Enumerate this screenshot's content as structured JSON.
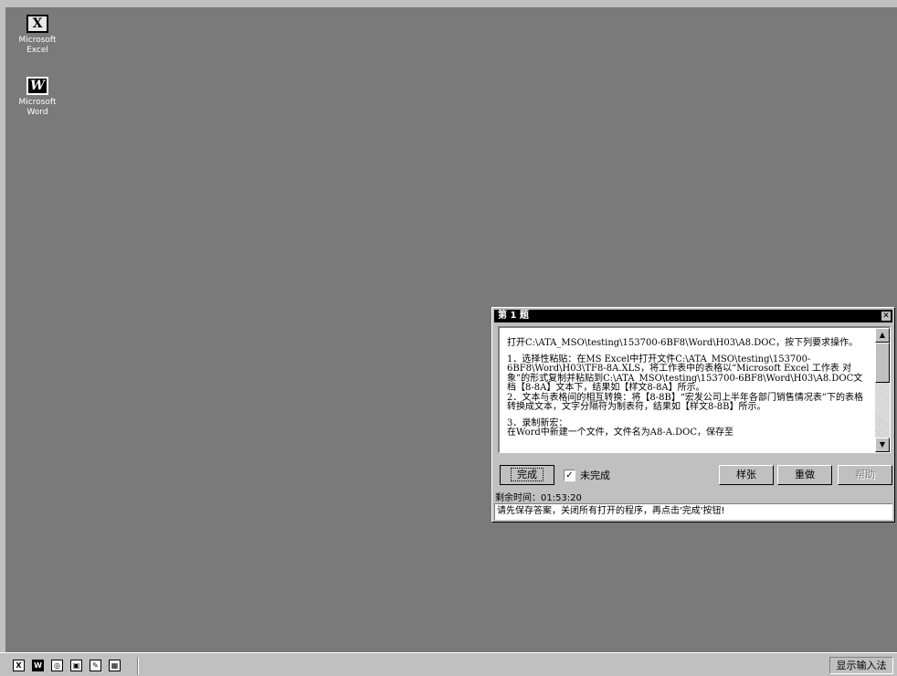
{
  "desktop": {
    "icons": [
      {
        "name": "Microsoft Excel",
        "line1": "Microsoft",
        "line2": "Excel",
        "glyph": "X"
      },
      {
        "name": "Microsoft Word",
        "line1": "Microsoft",
        "line2": "Word",
        "glyph": "W"
      }
    ]
  },
  "dialog": {
    "title": "第 1 题",
    "close_glyph": "✕",
    "paragraphs": [
      "打开C:\\ATA_MSO\\testing\\153700-6BF8\\Word\\H03\\A8.DOC，按下列要求操作。",
      "1．选择性粘贴：在MS Excel中打开文件C:\\ATA_MSO\\testing\\153700-6BF8\\Word\\H03\\TF8-8A.XLS，将工作表中的表格以“Microsoft Excel 工作表 对象”的形式复制并粘贴到C:\\ATA_MSO\\testing\\153700-6BF8\\Word\\H03\\A8.DOC文档【8-8A】文本下，结果如【样文8-8A】所示。\n2．文本与表格间的相互转换：将【8-8B】“宏发公司上半年各部门销售情况表”下的表格转换成文本，文字分隔符为制表符，结果如【样文8-8B】所示。",
      "3．录制新宏：\n在Word中新建一个文件，文件名为A8-A.DOC，保存至"
    ],
    "buttons": {
      "finish": "完成",
      "sample": "样张",
      "redo": "重做",
      "help": "帮助"
    },
    "checkbox": {
      "label": "未完成",
      "checked": true,
      "mark": "✓"
    },
    "timer_label": "剩余时间：",
    "timer_value": "01:53:20",
    "hint": "请先保存答案，关闭所有打开的程序，再点击'完成'按钮!"
  },
  "taskbar": {
    "quick_launch": [
      {
        "icon": "excel-icon",
        "glyph": "X"
      },
      {
        "icon": "word-icon",
        "glyph": "W"
      },
      {
        "icon": "web-icon",
        "glyph": "◎"
      },
      {
        "icon": "ppt-icon",
        "glyph": "▣"
      },
      {
        "icon": "pen-icon",
        "glyph": "✎"
      },
      {
        "icon": "image-icon",
        "glyph": "▦"
      }
    ],
    "ime_label": "显示输入法"
  }
}
